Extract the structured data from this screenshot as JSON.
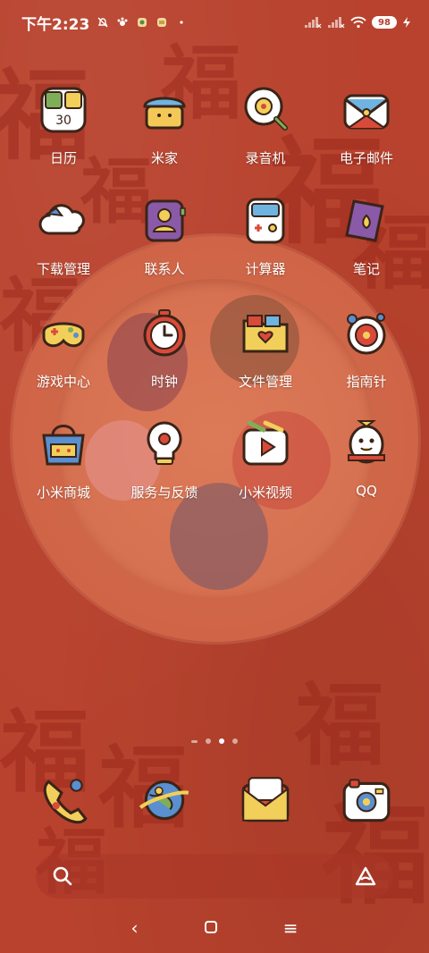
{
  "status_bar": {
    "time": "下午2:23",
    "battery": "98",
    "left_icons": [
      "mute-bell-icon",
      "paw-notification-icon",
      "app-notification-icon",
      "app-notification-icon",
      "dot-icon"
    ],
    "right_icons": [
      "signal-1-icon",
      "signal-2-icon",
      "wifi-icon",
      "battery-icon",
      "charging-icon"
    ]
  },
  "apps": [
    {
      "id": "calendar",
      "label": "日历",
      "icon": "calendar-icon",
      "badge": "30"
    },
    {
      "id": "mijia",
      "label": "米家",
      "icon": "mijia-icon"
    },
    {
      "id": "recorder",
      "label": "录音机",
      "icon": "recorder-icon"
    },
    {
      "id": "email",
      "label": "电子邮件",
      "icon": "email-icon"
    },
    {
      "id": "downloads",
      "label": "下载管理",
      "icon": "download-cloud-icon"
    },
    {
      "id": "contacts",
      "label": "联系人",
      "icon": "contacts-icon"
    },
    {
      "id": "calculator",
      "label": "计算器",
      "icon": "calculator-icon"
    },
    {
      "id": "notes",
      "label": "笔记",
      "icon": "notes-icon"
    },
    {
      "id": "games",
      "label": "游戏中心",
      "icon": "gamepad-icon"
    },
    {
      "id": "clock",
      "label": "时钟",
      "icon": "clock-icon"
    },
    {
      "id": "files",
      "label": "文件管理",
      "icon": "folder-icon"
    },
    {
      "id": "compass",
      "label": "指南针",
      "icon": "compass-icon"
    },
    {
      "id": "mistore",
      "label": "小米商城",
      "icon": "shopping-bag-icon"
    },
    {
      "id": "feedback",
      "label": "服务与反馈",
      "icon": "lightbulb-icon"
    },
    {
      "id": "mivideo",
      "label": "小米视频",
      "icon": "video-icon"
    },
    {
      "id": "qq",
      "label": "QQ",
      "icon": "penguin-icon"
    }
  ],
  "dock": [
    {
      "id": "phone",
      "icon": "phone-icon"
    },
    {
      "id": "browser",
      "icon": "planet-browser-icon"
    },
    {
      "id": "messages",
      "icon": "message-envelope-icon"
    },
    {
      "id": "camera",
      "icon": "camera-icon"
    }
  ],
  "page_indicator": {
    "pages": 4,
    "active": 3
  },
  "search": {
    "left_icon": "search-icon",
    "right_icon": "assistant-icon"
  },
  "nav": {
    "back": "‹",
    "home": "▢",
    "menu": "≡"
  },
  "colors": {
    "background": "#b8422d",
    "plate": "#d36d4d",
    "icon_outline": "#3a2418",
    "label": "#ffffff"
  }
}
